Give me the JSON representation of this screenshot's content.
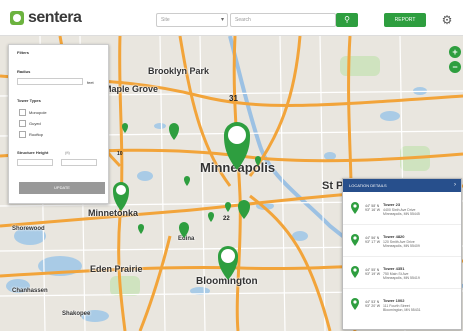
{
  "brand": {
    "name": "sentera",
    "accent": "#2e9e3f"
  },
  "header": {
    "select_placeholder": "Site",
    "search_placeholder": "Search",
    "report_label": "REPORT"
  },
  "filters": {
    "title": "Filters",
    "radius_label": "Radius",
    "radius_unit": "feet",
    "tower_types_label": "Tower Types",
    "types": [
      "Monopole",
      "Guyed",
      "Rooftop"
    ],
    "height_label": "Structure Height",
    "height_unit": "(ft)",
    "apply_label": "UPDATE"
  },
  "map": {
    "labels": [
      "Brooklyn Park",
      "Maple Grove",
      "Minneapolis",
      "St P",
      "Minnetonka",
      "Shorewood",
      "Edina",
      "Eden Prairie",
      "Bloomington",
      "Chanhassen",
      "Shakopee"
    ],
    "clusters": [
      "31",
      "10",
      "22"
    ]
  },
  "locations_panel": {
    "title": "LOCATION DETAILS",
    "items": [
      {
        "name": "Tower 23",
        "coords": "44° 58' N\n93° 16' W",
        "address": "4400 Sixth Ave Drive\nMinneapolis, MN 55445"
      },
      {
        "name": "Tower 4820",
        "coords": "44° 56' N\n93° 17' W",
        "address": "120 Smith Ave Drive\nMinneapolis, MN 55409"
      },
      {
        "name": "Tower 4351",
        "coords": "44° 55' N\n93° 19' W",
        "address": "750 Main St Ave\nMinneapolis, MN 55419"
      },
      {
        "name": "Tower 1002",
        "coords": "44° 53' N\n93° 20' W",
        "address": "111 Fourth Street\nBloomington, MN 55431"
      }
    ]
  }
}
